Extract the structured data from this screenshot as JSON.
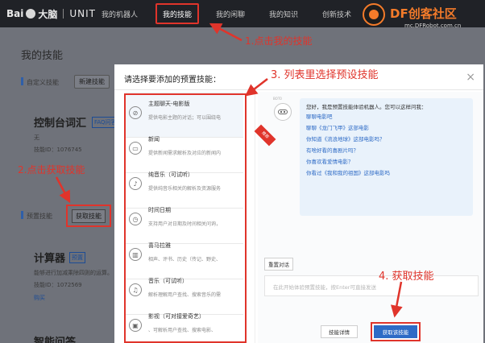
{
  "nav": {
    "logo_brand": "Bai",
    "logo_suffix": "大脑",
    "logo_product": "UNIT",
    "items": [
      "我的机器人",
      "我的技能",
      "我的闲聊",
      "我的知识",
      "创新技术",
      "技"
    ],
    "highlight_color": "#e0342b"
  },
  "watermark": {
    "title": "DF创客社区",
    "url": "mc.DFRobot.com.cn",
    "accent": "#f47b2a"
  },
  "page": {
    "title": "我的技能",
    "custom_label": "自定义技能",
    "new_skill_button": "新建技能",
    "console_title": "控制台词汇",
    "faq_tag": "FAQ问答",
    "console_none": "无",
    "console_id": "技能ID：1076745",
    "preset_label": "预置技能",
    "get_skill_button": "获取技能",
    "calc_title": "计算器",
    "calc_tag": "预置",
    "calc_desc": "能够进行加减乘除四则的运算。",
    "calc_id": "技能ID：1072569",
    "buy_link": "购买",
    "bottom_title": "智能问答"
  },
  "modal": {
    "title": "请选择要添加的预置技能：",
    "close_icon": "close-icon",
    "ribbon": "推荐",
    "skills": [
      {
        "name": "主题聊天-电影版",
        "desc": "提供电影主题的对话；可以围绕电",
        "icon": "chat-icon",
        "glyph": "⊘"
      },
      {
        "name": "新闻",
        "desc": "提供新闻需求解析及对应的新闻内",
        "icon": "news-icon",
        "glyph": "▭"
      },
      {
        "name": "纯音乐（可试听）",
        "desc": "提供纯音乐相关的解析及资源服务",
        "icon": "music-note-icon",
        "glyph": "♪"
      },
      {
        "name": "时间日期",
        "desc": "支持用户对日期及时间相关问询，",
        "icon": "clock-icon",
        "glyph": "◷"
      },
      {
        "name": "喜马拉雅",
        "desc": "相声、评书、历史（传记、野史、",
        "icon": "book-icon",
        "glyph": "▥"
      },
      {
        "name": "音乐（可试听）",
        "desc": "解析理解用户查找、搜索音乐的需",
        "icon": "music-icon",
        "glyph": "♫"
      },
      {
        "name": "影视（可对接爱奇艺）",
        "desc": "、可解析用户查找、搜索电影、",
        "icon": "film-icon",
        "glyph": "▣"
      }
    ],
    "bot_label": "BOT0",
    "chat_intro": "您好，我是预置技能体验机器人。您可以这样问我：",
    "chat_examples": [
      "聊聊电影吧",
      "聊聊《龙门飞甲》这部电影",
      "你知道《流浪地球》这部电影吗？",
      "有啥好看的喜剧片吗？",
      "你喜欢看爱情电影？",
      "你看过《我和我的祖国》这部电影吗"
    ],
    "reset_button": "重置对话",
    "input_placeholder": "在此开始体验预置技能，按Enter可直接发送",
    "detail_button": "技能详情",
    "get_this_button": "获取该技能"
  },
  "annotations": {
    "step1": "1.点击我的技能",
    "step2": "2.点击获取技能",
    "step3": "3. 列表里选择预设技能",
    "step4": "4. 获取技能",
    "color": "#e0342b"
  }
}
